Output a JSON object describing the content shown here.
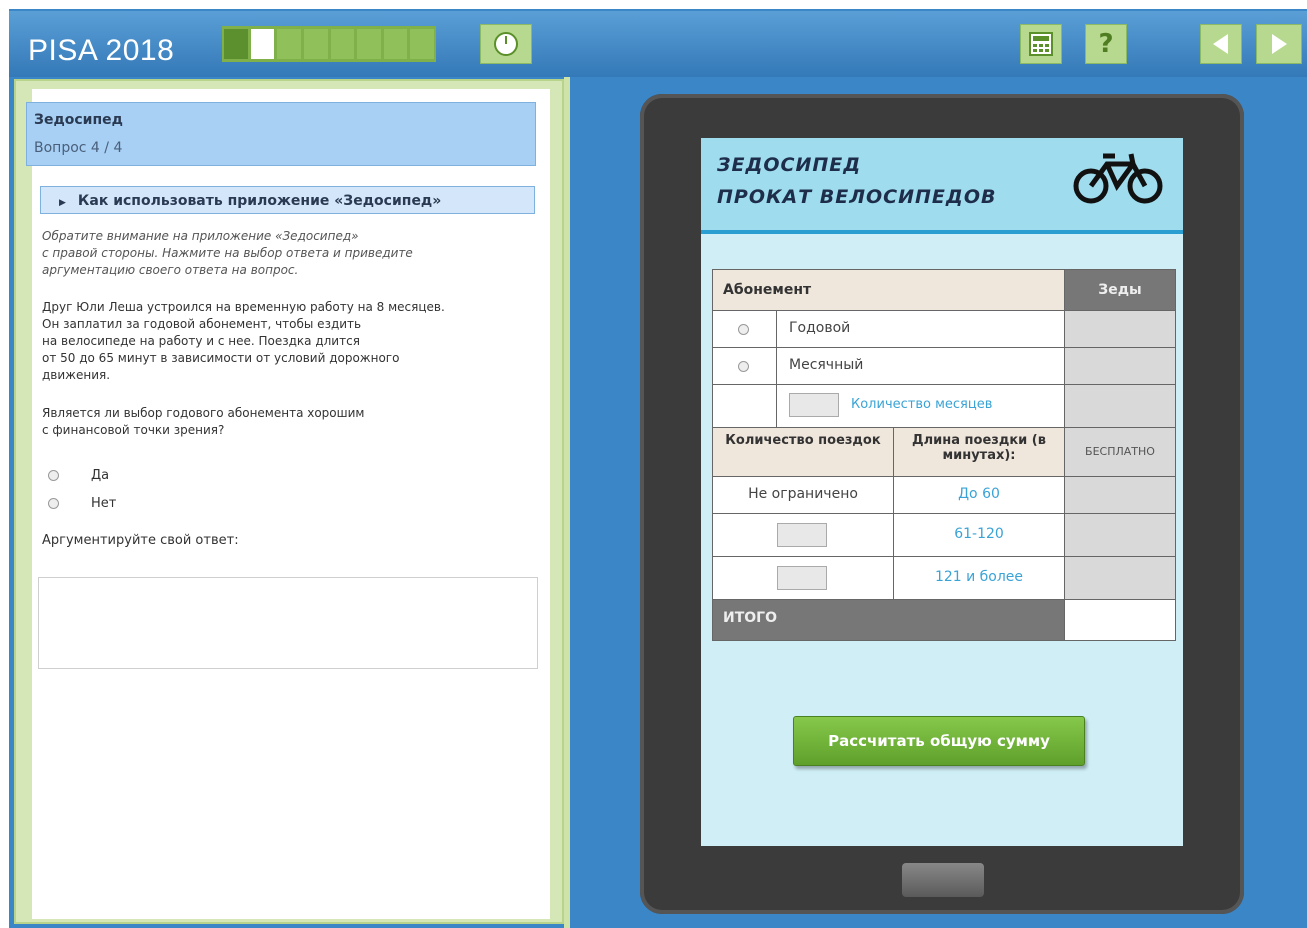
{
  "topbar": {
    "brand": "PISA 2018",
    "progress_segments": 8,
    "progress_current_index": 1,
    "icons": [
      "timer-icon",
      "calculator-icon",
      "help-icon",
      "previous-arrow-icon",
      "next-arrow-icon"
    ],
    "help_label": "?"
  },
  "left": {
    "title": "Зедосипед",
    "question_num": "Вопрос 4 / 4",
    "howto": "Как использовать приложение «Зедосипед»",
    "instruction": "Обратите внимание на приложение «Зедосипед»\nс правой стороны. Нажмите на выбор ответа и приведите\nаргументацию своего ответа на вопрос.",
    "story": "Друг Юли Леша устроился на временную работу на 8 месяцев.\nОн заплатил за годовой абонемент, чтобы ездить\nна велосипеде на работу и с нее. Поездка длится\nот 50 до 65 минут в зависимости от условий дорожного\nдвижения.",
    "question": "Является ли выбор годового абонемента хорошим\nс финансовой точки зрения?",
    "options": [
      "Да",
      "Нет"
    ],
    "argue_label": "Аргументируйте свой ответ:"
  },
  "app": {
    "title_line1": "ЗЕДОСИПЕД",
    "title_line2": "ПРОКАТ ВЕЛОСИПЕДОВ",
    "col_subscription": "Абонемент",
    "col_zedy": "Зеды",
    "opt_yearly": "Годовой",
    "opt_monthly": "Месячный",
    "months_label": "Количество месяцев",
    "col_trips": "Количество поездок",
    "col_duration": "Длина поездки (в минутах):",
    "free": "БЕСПЛАТНО",
    "unlimited": "Не ограничено",
    "dur1": "До 60",
    "dur2": "61-120",
    "dur3": "121 и более",
    "total": "ИТОГО",
    "calc_button": "Рассчитать общую сумму"
  },
  "colors": {
    "frame_blue": "#3a86c6",
    "accent_green": "#6fb03a",
    "app_header": "#9fdcee",
    "screen_bg": "#cfeef6"
  }
}
